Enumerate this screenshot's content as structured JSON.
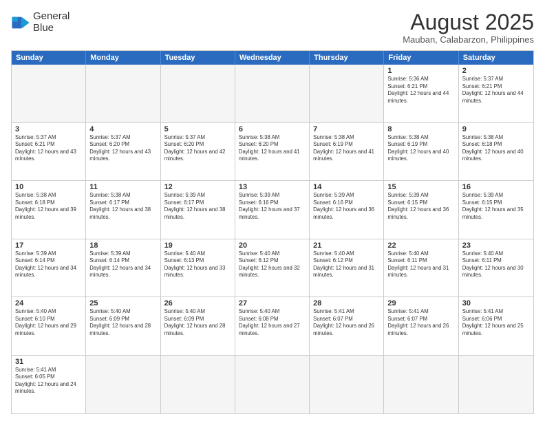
{
  "header": {
    "logo": {
      "line1": "General",
      "line2": "Blue"
    },
    "title": "August 2025",
    "location": "Mauban, Calabarzon, Philippines"
  },
  "day_headers": [
    "Sunday",
    "Monday",
    "Tuesday",
    "Wednesday",
    "Thursday",
    "Friday",
    "Saturday"
  ],
  "weeks": [
    [
      {
        "date": "",
        "info": "",
        "empty": true
      },
      {
        "date": "",
        "info": "",
        "empty": true
      },
      {
        "date": "",
        "info": "",
        "empty": true
      },
      {
        "date": "",
        "info": "",
        "empty": true
      },
      {
        "date": "",
        "info": "",
        "empty": true
      },
      {
        "date": "1",
        "info": "Sunrise: 5:36 AM\nSunset: 6:21 PM\nDaylight: 12 hours and 44 minutes.",
        "empty": false
      },
      {
        "date": "2",
        "info": "Sunrise: 5:37 AM\nSunset: 6:21 PM\nDaylight: 12 hours and 44 minutes.",
        "empty": false
      }
    ],
    [
      {
        "date": "3",
        "info": "Sunrise: 5:37 AM\nSunset: 6:21 PM\nDaylight: 12 hours and 43 minutes.",
        "empty": false
      },
      {
        "date": "4",
        "info": "Sunrise: 5:37 AM\nSunset: 6:20 PM\nDaylight: 12 hours and 43 minutes.",
        "empty": false
      },
      {
        "date": "5",
        "info": "Sunrise: 5:37 AM\nSunset: 6:20 PM\nDaylight: 12 hours and 42 minutes.",
        "empty": false
      },
      {
        "date": "6",
        "info": "Sunrise: 5:38 AM\nSunset: 6:20 PM\nDaylight: 12 hours and 41 minutes.",
        "empty": false
      },
      {
        "date": "7",
        "info": "Sunrise: 5:38 AM\nSunset: 6:19 PM\nDaylight: 12 hours and 41 minutes.",
        "empty": false
      },
      {
        "date": "8",
        "info": "Sunrise: 5:38 AM\nSunset: 6:19 PM\nDaylight: 12 hours and 40 minutes.",
        "empty": false
      },
      {
        "date": "9",
        "info": "Sunrise: 5:38 AM\nSunset: 6:18 PM\nDaylight: 12 hours and 40 minutes.",
        "empty": false
      }
    ],
    [
      {
        "date": "10",
        "info": "Sunrise: 5:38 AM\nSunset: 6:18 PM\nDaylight: 12 hours and 39 minutes.",
        "empty": false
      },
      {
        "date": "11",
        "info": "Sunrise: 5:38 AM\nSunset: 6:17 PM\nDaylight: 12 hours and 38 minutes.",
        "empty": false
      },
      {
        "date": "12",
        "info": "Sunrise: 5:39 AM\nSunset: 6:17 PM\nDaylight: 12 hours and 38 minutes.",
        "empty": false
      },
      {
        "date": "13",
        "info": "Sunrise: 5:39 AM\nSunset: 6:16 PM\nDaylight: 12 hours and 37 minutes.",
        "empty": false
      },
      {
        "date": "14",
        "info": "Sunrise: 5:39 AM\nSunset: 6:16 PM\nDaylight: 12 hours and 36 minutes.",
        "empty": false
      },
      {
        "date": "15",
        "info": "Sunrise: 5:39 AM\nSunset: 6:15 PM\nDaylight: 12 hours and 36 minutes.",
        "empty": false
      },
      {
        "date": "16",
        "info": "Sunrise: 5:39 AM\nSunset: 6:15 PM\nDaylight: 12 hours and 35 minutes.",
        "empty": false
      }
    ],
    [
      {
        "date": "17",
        "info": "Sunrise: 5:39 AM\nSunset: 6:14 PM\nDaylight: 12 hours and 34 minutes.",
        "empty": false
      },
      {
        "date": "18",
        "info": "Sunrise: 5:39 AM\nSunset: 6:14 PM\nDaylight: 12 hours and 34 minutes.",
        "empty": false
      },
      {
        "date": "19",
        "info": "Sunrise: 5:40 AM\nSunset: 6:13 PM\nDaylight: 12 hours and 33 minutes.",
        "empty": false
      },
      {
        "date": "20",
        "info": "Sunrise: 5:40 AM\nSunset: 6:12 PM\nDaylight: 12 hours and 32 minutes.",
        "empty": false
      },
      {
        "date": "21",
        "info": "Sunrise: 5:40 AM\nSunset: 6:12 PM\nDaylight: 12 hours and 31 minutes.",
        "empty": false
      },
      {
        "date": "22",
        "info": "Sunrise: 5:40 AM\nSunset: 6:11 PM\nDaylight: 12 hours and 31 minutes.",
        "empty": false
      },
      {
        "date": "23",
        "info": "Sunrise: 5:40 AM\nSunset: 6:11 PM\nDaylight: 12 hours and 30 minutes.",
        "empty": false
      }
    ],
    [
      {
        "date": "24",
        "info": "Sunrise: 5:40 AM\nSunset: 6:10 PM\nDaylight: 12 hours and 29 minutes.",
        "empty": false
      },
      {
        "date": "25",
        "info": "Sunrise: 5:40 AM\nSunset: 6:09 PM\nDaylight: 12 hours and 28 minutes.",
        "empty": false
      },
      {
        "date": "26",
        "info": "Sunrise: 5:40 AM\nSunset: 6:09 PM\nDaylight: 12 hours and 28 minutes.",
        "empty": false
      },
      {
        "date": "27",
        "info": "Sunrise: 5:40 AM\nSunset: 6:08 PM\nDaylight: 12 hours and 27 minutes.",
        "empty": false
      },
      {
        "date": "28",
        "info": "Sunrise: 5:41 AM\nSunset: 6:07 PM\nDaylight: 12 hours and 26 minutes.",
        "empty": false
      },
      {
        "date": "29",
        "info": "Sunrise: 5:41 AM\nSunset: 6:07 PM\nDaylight: 12 hours and 26 minutes.",
        "empty": false
      },
      {
        "date": "30",
        "info": "Sunrise: 5:41 AM\nSunset: 6:06 PM\nDaylight: 12 hours and 25 minutes.",
        "empty": false
      }
    ],
    [
      {
        "date": "31",
        "info": "Sunrise: 5:41 AM\nSunset: 6:05 PM\nDaylight: 12 hours and 24 minutes.",
        "empty": false
      },
      {
        "date": "",
        "info": "",
        "empty": true
      },
      {
        "date": "",
        "info": "",
        "empty": true
      },
      {
        "date": "",
        "info": "",
        "empty": true
      },
      {
        "date": "",
        "info": "",
        "empty": true
      },
      {
        "date": "",
        "info": "",
        "empty": true
      },
      {
        "date": "",
        "info": "",
        "empty": true
      }
    ]
  ]
}
